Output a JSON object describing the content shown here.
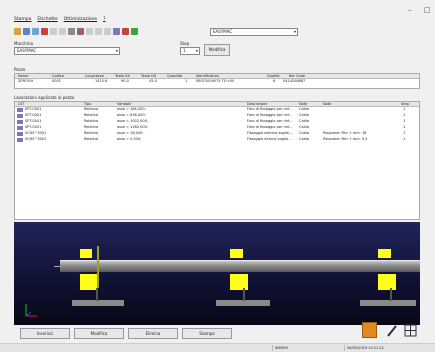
{
  "window": {
    "minimize": "–",
    "maximize": "□"
  },
  "menu": [
    "Stampa",
    "Etichette",
    "Ottimizzazione",
    "?"
  ],
  "machine": {
    "label": "Macchina",
    "value": "EASYMAC",
    "step_label": "Step",
    "step_value": "1",
    "modify_label": "Modifica",
    "toolbar_combo": "EASYMAC"
  },
  "pieces": {
    "label": "Pezzo",
    "columns": [
      "Nome",
      "Codice",
      "Lunghezza",
      "Testa SX",
      "Testa DX",
      "Quantita",
      "Identificativo",
      "Qualità",
      "Bar Code"
    ],
    "rows": [
      [
        "ZEROOH",
        "0001",
        "1415.6",
        "90.0",
        "45.0",
        "1",
        "08072009075 TI1+00",
        "6",
        "0414208887"
      ]
    ]
  },
  "operations": {
    "label": "Lavorazioni applicate al pezzo",
    "columns": [
      "LST",
      "Tipo",
      "Variabili",
      "Descrizione",
      "Note",
      "Note",
      "Step"
    ],
    "rows": [
      [
        "SPT-0001",
        "Relativa",
        "asse = 184,000;",
        "Foro di fissaggio per rinf...",
        "Calda",
        "",
        "1"
      ],
      [
        "SPT-0001",
        "Relativa",
        "asse = 636,000;",
        "Foro di fissaggio per rinf...",
        "Calda",
        "",
        "1"
      ],
      [
        "SPT-0001",
        "Relativa",
        "asse = 1002,000;",
        "Foro di fissaggio per rinf...",
        "Calda",
        "",
        "1"
      ],
      [
        "SPT-0001",
        "Relativa",
        "asse = 1260,000;",
        "Foro di fissaggio per rinf...",
        "Calda",
        "",
        "1"
      ],
      [
        "SCHS^5001",
        "Relativa",
        "asse = 18,000;",
        "Fissaggio esterno soglia ...",
        "Calda",
        "Posizione: Min + mm. 18",
        "1"
      ],
      [
        "SCHS^5001",
        "Relativa",
        "asse = 0,500;",
        "Fissaggio interno soglia ...",
        "Calda",
        "Posizione: Min + mm. 0,5",
        "1"
      ]
    ]
  },
  "buttons": {
    "insert": "Inserisci",
    "modify": "Modifica",
    "delete": "Elimina",
    "print": "Stampa"
  },
  "status": {
    "left": "",
    "mid": "INSERH",
    "right": "08/05/2019 15:11:21"
  },
  "colors": {
    "icon_lavorazione": "#7a7ab8",
    "blocks_yellow": "#ffff1a",
    "view_background": "#101236"
  }
}
